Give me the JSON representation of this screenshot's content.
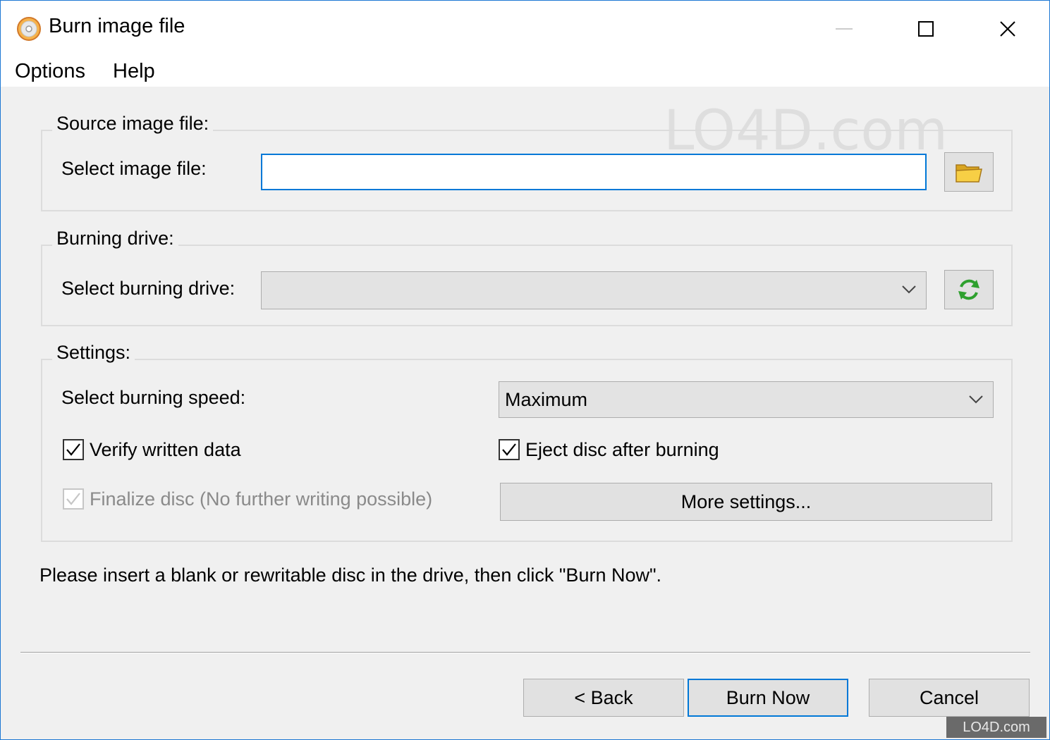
{
  "window": {
    "title": "Burn image file",
    "icon": "disc-burn-icon"
  },
  "menu": {
    "options_label": "Options",
    "help_label": "Help"
  },
  "source_group": {
    "legend": "Source image file:",
    "select_label": "Select image file:",
    "file_value": "",
    "browse_icon": "folder-icon"
  },
  "drive_group": {
    "legend": "Burning drive:",
    "select_label": "Select burning drive:",
    "drive_value": "",
    "refresh_icon": "refresh-icon"
  },
  "settings_group": {
    "legend": "Settings:",
    "speed_label": "Select burning speed:",
    "speed_value": "Maximum",
    "verify_label": "Verify written data",
    "verify_checked": true,
    "eject_label": "Eject disc after burning",
    "eject_checked": true,
    "finalize_label": "Finalize disc (No further writing possible)",
    "finalize_checked": true,
    "finalize_enabled": false,
    "more_settings_label": "More settings..."
  },
  "status_text": "Please insert a blank or rewritable disc in the drive, then click \"Burn Now\".",
  "buttons": {
    "back_label": "< Back",
    "burn_label": "Burn Now",
    "cancel_label": "Cancel"
  },
  "watermark": {
    "text": "LO4D.com"
  },
  "colors": {
    "accent": "#0078d7",
    "window_bg": "#f0f0f0",
    "disabled_text": "#8a8a8a"
  }
}
